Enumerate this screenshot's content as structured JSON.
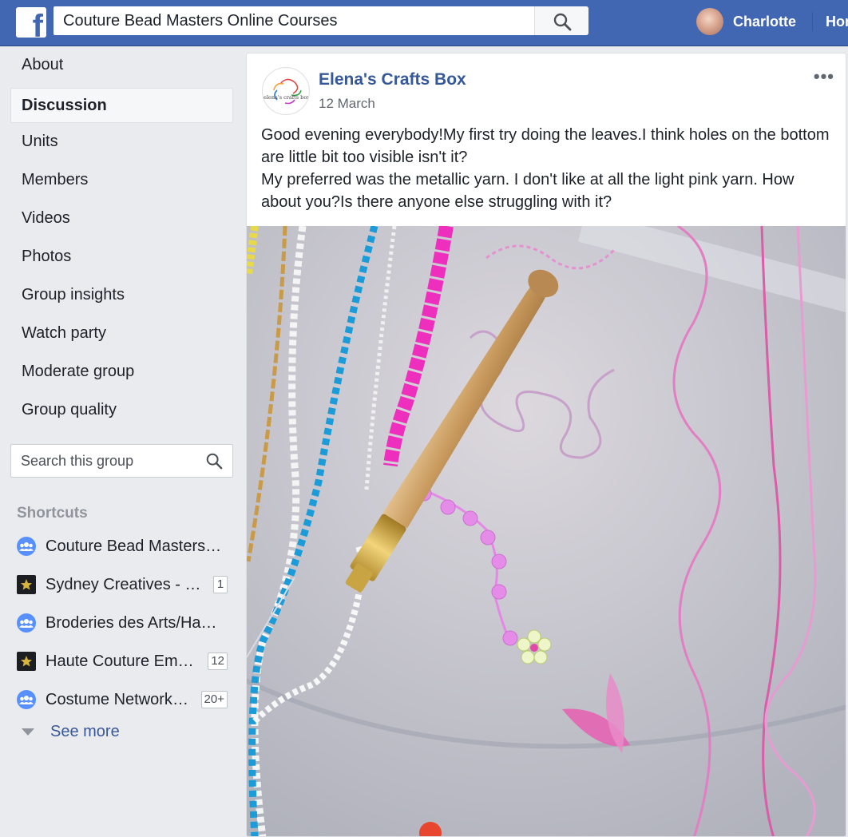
{
  "topbar": {
    "logo": "f",
    "search_value": "Couture Bead Masters Online Courses",
    "user_name": "Charlotte",
    "home_label": "Home"
  },
  "nav": {
    "items": [
      {
        "label": "About"
      },
      {
        "label": "Discussion",
        "active": true
      },
      {
        "label": "Units"
      },
      {
        "label": "Members"
      },
      {
        "label": "Videos"
      },
      {
        "label": "Photos"
      },
      {
        "label": "Group insights"
      },
      {
        "label": "Watch party"
      },
      {
        "label": "Moderate group"
      },
      {
        "label": "Group quality"
      }
    ],
    "search_placeholder": "Search this group"
  },
  "shortcuts": {
    "title": "Shortcuts",
    "items": [
      {
        "label": "Couture Bead Masters Online Courses",
        "icon": "group-icon",
        "badge": ""
      },
      {
        "label": "Sydney Creatives - Designers",
        "icon": "page-star-icon",
        "badge": "1"
      },
      {
        "label": "Broderies des Arts/Haute Couture",
        "icon": "group-icon",
        "badge": ""
      },
      {
        "label": "Haute Couture Embroidery",
        "icon": "page-star-icon",
        "badge": "12"
      },
      {
        "label": "Costume Networking Group",
        "icon": "group-icon",
        "badge": "20+"
      }
    ],
    "see_more": "See more"
  },
  "post": {
    "author": "Elena's Crafts Box",
    "avatar_text": "elena's crafts box",
    "date": "12 March",
    "menu": "•••",
    "lines": [
      "Good evening everybody!My first try doing the leaves.I think holes on the bottom are little bit too visible isn't it?",
      "My preferred was the metallic yarn. I don't like at all the light pink yarn. How about you?Is there anyone else struggling with it?"
    ]
  },
  "colors": {
    "brand": "#4267b2",
    "link": "#365899",
    "background": "#e9ebee"
  }
}
